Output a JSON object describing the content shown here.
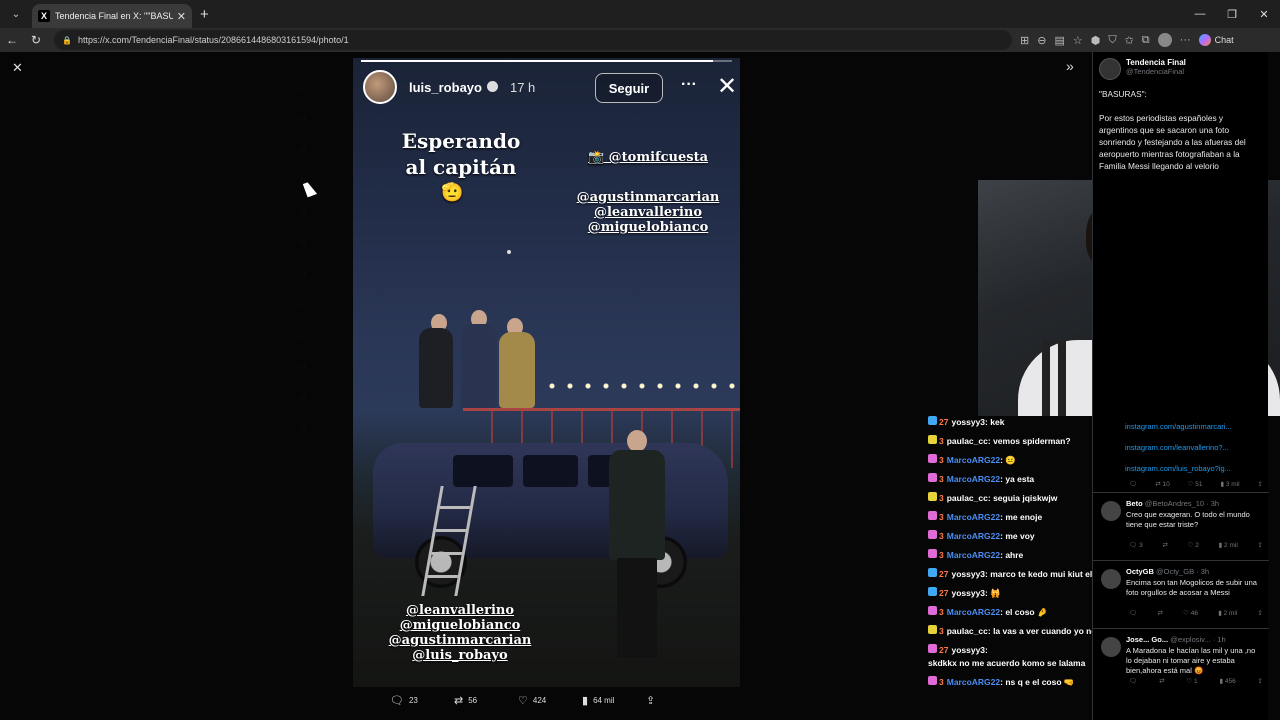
{
  "browser": {
    "tab_title": "Tendencia Final en X: \"\"BASURAS\"",
    "tab_logo": "X",
    "url": "https://x.com/TendenciaFinal/status/2086614486803161594/photo/1",
    "chat_label": "Chat",
    "icons": [
      "back-icon",
      "refresh-icon",
      "lock-icon",
      "translate-icon",
      "zoom-icon",
      "reader-icon",
      "star-icon",
      "extensions-icon",
      "profile-icon",
      "more-icon",
      "copilot-icon"
    ]
  },
  "story": {
    "username": "luis_robayo",
    "time": "17 h",
    "follow_label": "Seguir",
    "more": "···",
    "close": "✕",
    "progress": 0.95,
    "headline_line1": "Esperando",
    "headline_line2": "al capitán",
    "headline_emoji": "🫡",
    "mention_top": "📸 @tomifcuesta",
    "mentions_right": [
      "@agustinmarcarian",
      "@leanvallerino",
      "@miguelobianco"
    ],
    "mentions_bottom": [
      "@leanvallerino",
      "@miguelobianco",
      "@agustinmarcarian",
      "@luis_robayo"
    ]
  },
  "post_stats": {
    "replies": "23",
    "reposts": "56",
    "likes": "424",
    "views": "64 mil"
  },
  "chat": [
    {
      "badge_color": "#3fa9f5",
      "level": "27",
      "user": "yossyy3",
      "user_color": "#ffffff",
      "msg": "kek"
    },
    {
      "badge_color": "#e6d23a",
      "level": "3",
      "user": "paulac_cc",
      "user_color": "#ffffff",
      "msg": "vemos spiderman?"
    },
    {
      "badge_color": "#e06bd6",
      "level": "3",
      "user": "MarcoARG22",
      "user_color": "#4b8ef5",
      "msg": "😐"
    },
    {
      "badge_color": "#e06bd6",
      "level": "3",
      "user": "MarcoARG22",
      "user_color": "#4b8ef5",
      "msg": "ya esta"
    },
    {
      "badge_color": "#e6d23a",
      "level": "3",
      "user": "paulac_cc",
      "user_color": "#ffffff",
      "msg": "seguia jqiskwjw"
    },
    {
      "badge_color": "#e06bd6",
      "level": "3",
      "user": "MarcoARG22",
      "user_color": "#4b8ef5",
      "msg": "me enoje"
    },
    {
      "badge_color": "#e06bd6",
      "level": "3",
      "user": "MarcoARG22",
      "user_color": "#4b8ef5",
      "msg": "me voy"
    },
    {
      "badge_color": "#e06bd6",
      "level": "3",
      "user": "MarcoARG22",
      "user_color": "#4b8ef5",
      "msg": "ahre"
    },
    {
      "badge_color": "#3fa9f5",
      "level": "27",
      "user": "yossyy3",
      "user_color": "#ffffff",
      "msg": "marco te kedo mui kiut el coso"
    },
    {
      "badge_color": "#3fa9f5",
      "level": "27",
      "user": "yossyy3",
      "user_color": "#ffffff",
      "msg": "🙀"
    },
    {
      "badge_color": "#e06bd6",
      "level": "3",
      "user": "MarcoARG22",
      "user_color": "#4b8ef5",
      "msg": "el coso 🤌"
    },
    {
      "badge_color": "#e6d23a",
      "level": "3",
      "user": "paulac_cc",
      "user_color": "#ffffff",
      "msg": "la vas a ver cuando yo no este"
    },
    {
      "badge_color": "#e06bd6",
      "level": "27",
      "user": "yossyy3",
      "user_color": "#ffffff",
      "msg": "",
      "continuation": "skdkkx no me acuerdo komo se lalama"
    },
    {
      "badge_color": "#e06bd6",
      "level": "3",
      "user": "MarcoARG22",
      "user_color": "#4b8ef5",
      "msg": "ns q e el coso 🤜"
    }
  ],
  "tweet": {
    "name": "Tendencia Final",
    "handle": "@TendenciaFinal",
    "line1": "\"BASURAS\":",
    "body": "Por estos periodistas españoles y argentinos que se sacaron una foto sonriendo y festejando a las afueras del aeropuerto mientras fotografiaban a la Familia Messi llegando al velorio",
    "links": [
      "instagram.com/agustinmarcari...",
      "instagram.com/leanvallerino?...",
      "instagram.com/luis_robayo?ig..."
    ],
    "actions": [
      "10",
      "51",
      "3 mil"
    ]
  },
  "replies": [
    {
      "name": "Beto",
      "handle": "@BetoAndres_10 · 3h",
      "text": "Creo que exageran. O todo el mundo tiene que estar triste?",
      "actions": [
        "3",
        "",
        "2",
        "2 mil"
      ]
    },
    {
      "name": "OctyGB",
      "handle": "@Octy_GB · 3h",
      "text": "Encima son tan Mogolicos de subir una foto orgullos de acosar a Messi",
      "actions": [
        "",
        "",
        "46",
        "2 mil"
      ]
    },
    {
      "name": "Jose... Go...",
      "handle": "@explosiv... · 1h",
      "text": "A Maradona le hacían las mil y una ,no lo dejaban ni tomar aire y estaba bien,ahora está mal 😡",
      "actions": [
        "",
        "",
        "1",
        "456"
      ]
    }
  ]
}
